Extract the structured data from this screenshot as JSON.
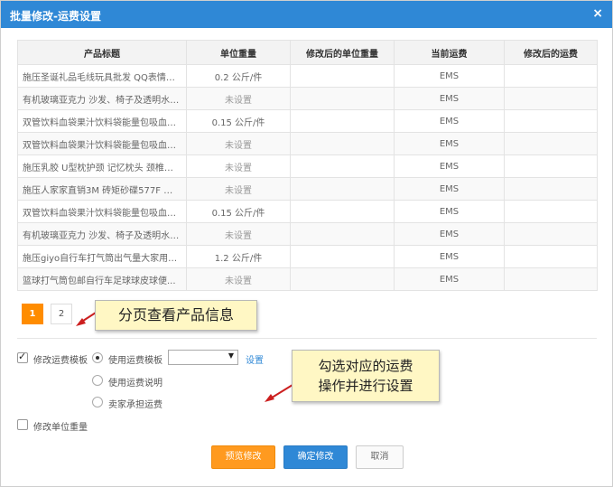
{
  "dialog": {
    "title": "批量修改-运费设置",
    "close_symbol": "×"
  },
  "table": {
    "headers": [
      "产品标题",
      "单位重量",
      "修改后的单位重量",
      "当前运费",
      "修改后的运费"
    ],
    "rows": [
      {
        "title": "施压圣诞礼品毛线玩具批发 QQ表情抱...",
        "weight": "0.2 公斤/件",
        "new_weight": "",
        "freight": "EMS",
        "new_freight": ""
      },
      {
        "title": "有机玻璃亚克力 沙发、椅子及透明水晶...",
        "weight": "未设置",
        "new_weight": "",
        "freight": "EMS",
        "new_freight": ""
      },
      {
        "title": "双管饮料血袋果汁饮料袋能量包吸血鬼...",
        "weight": "0.15 公斤/件",
        "new_weight": "",
        "freight": "EMS",
        "new_freight": ""
      },
      {
        "title": "双管饮料血袋果汁饮料袋能量包吸血鬼...",
        "weight": "未设置",
        "new_weight": "",
        "freight": "EMS",
        "new_freight": ""
      },
      {
        "title": "施压乳胶 U型枕护颈 记忆枕头 颈椎治...",
        "weight": "未设置",
        "new_weight": "",
        "freight": "EMS",
        "new_freight": ""
      },
      {
        "title": "施压人家家直销3M 砖矩砂碟577F 铯刚...",
        "weight": "未设置",
        "new_weight": "",
        "freight": "EMS",
        "new_freight": ""
      },
      {
        "title": "双管饮料血袋果汁饮料袋能量包吸血鬼...",
        "weight": "0.15 公斤/件",
        "new_weight": "",
        "freight": "EMS",
        "new_freight": ""
      },
      {
        "title": "有机玻璃亚克力 沙发、椅子及透明水晶...",
        "weight": "未设置",
        "new_weight": "",
        "freight": "EMS",
        "new_freight": ""
      },
      {
        "title": "施压giyo自行车打气筒出气量大家用美...",
        "weight": "1.2 公斤/件",
        "new_weight": "",
        "freight": "EMS",
        "new_freight": ""
      },
      {
        "title": "篮球打气筒包邮自行车足球球皮球便...",
        "weight": "未设置",
        "new_weight": "",
        "freight": "EMS",
        "new_freight": ""
      }
    ]
  },
  "pagination": {
    "pages": [
      "1",
      "2"
    ],
    "current": "1"
  },
  "callouts": {
    "pager_note": "分页查看产品信息",
    "freight_note_line1": "勾选对应的运费",
    "freight_note_line2": "操作并进行设置"
  },
  "form": {
    "modify_template_label": "修改运费模板",
    "modify_template_checked": true,
    "radio_use_template": "使用运费模板",
    "radio_use_description": "使用运费说明",
    "radio_seller_pays": "卖家承担运费",
    "template_select_value": "",
    "settings_link": "设置",
    "modify_weight_label": "修改单位重量",
    "modify_weight_checked": false
  },
  "buttons": {
    "preview": "预览修改",
    "confirm": "确定修改",
    "cancel": "取消"
  },
  "colors": {
    "title_bar": "#2f88d6",
    "accent_orange": "#ff9a1f",
    "callout_bg": "#fff7c4",
    "callout_arrow": "#cc1f1f"
  }
}
